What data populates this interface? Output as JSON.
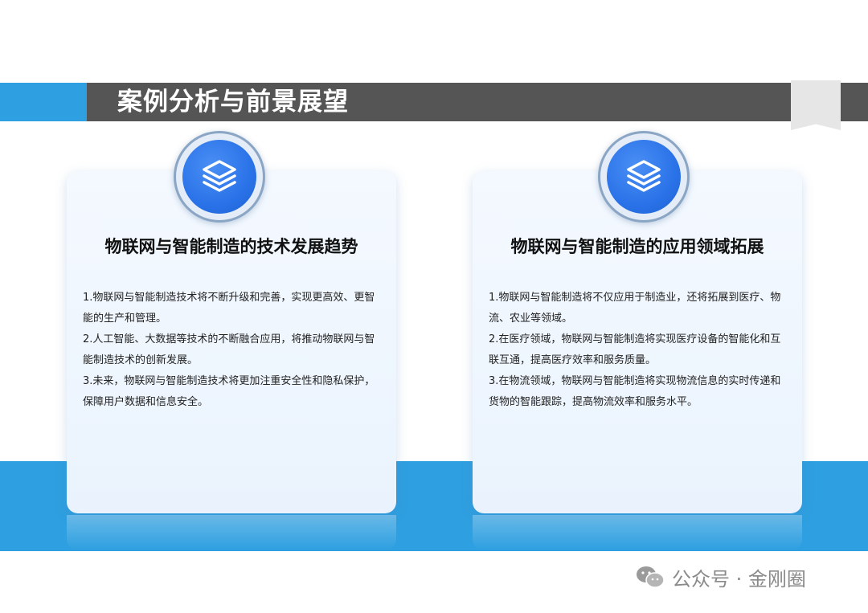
{
  "slide": {
    "title": "案例分析与前景展望"
  },
  "cards": [
    {
      "title": "物联网与智能制造的技术发展趋势",
      "icon": "layers-icon",
      "items": [
        "1.物联网与智能制造技术将不断升级和完善，实现更高效、更智能的生产和管理。",
        "2.人工智能、大数据等技术的不断融合应用，将推动物联网与智能制造技术的创新发展。",
        "3.未来，物联网与智能制造技术将更加注重安全性和隐私保护，保障用户数据和信息安全。"
      ]
    },
    {
      "title": "物联网与智能制造的应用领域拓展",
      "icon": "layers-icon",
      "items": [
        "1.物联网与智能制造将不仅应用于制造业，还将拓展到医疗、物流、农业等领域。",
        "2.在医疗领域，物联网与智能制造将实现医疗设备的智能化和互联互通，提高医疗效率和服务质量。",
        "3.在物流领域，物联网与智能制造将实现物流信息的实时传递和货物的智能跟踪，提高物流效率和服务水平。"
      ]
    }
  ],
  "watermark": {
    "text": "公众号 · 金刚圈",
    "icon": "wechat-icon"
  },
  "colors": {
    "accent_blue": "#2e9fe0",
    "title_bar": "#555555",
    "icon_blue": "#2a72e8"
  }
}
